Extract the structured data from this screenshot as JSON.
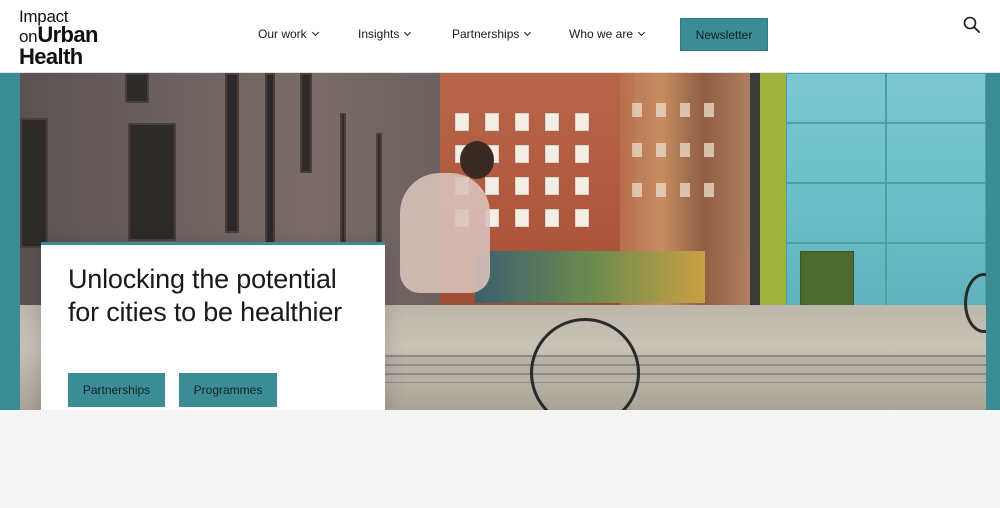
{
  "logo": {
    "line1": "Impact",
    "line2_small": "on",
    "line2_bold": "Urban",
    "line3": "Health"
  },
  "nav": {
    "items": [
      {
        "label": "Our work"
      },
      {
        "label": "Insights"
      },
      {
        "label": "Partnerships"
      },
      {
        "label": "Who we are"
      }
    ],
    "newsletter_label": "Newsletter"
  },
  "hero": {
    "title": "Unlocking the potential for cities to be healthier",
    "buttons": [
      {
        "label": "Partnerships"
      },
      {
        "label": "Programmes"
      }
    ]
  },
  "colors": {
    "accent": "#3b8c95",
    "text": "#1a1a1a"
  },
  "icons": {
    "search": "search-icon",
    "chevron": "chevron-down-icon"
  }
}
